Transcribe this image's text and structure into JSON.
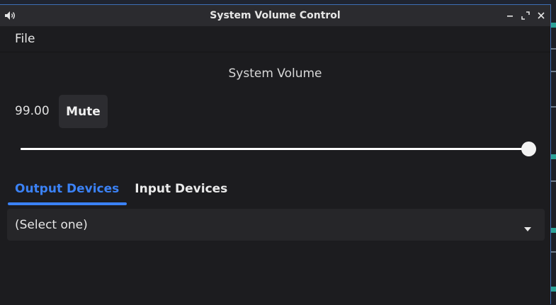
{
  "window": {
    "title": "System Volume Control"
  },
  "menu": {
    "items": [
      {
        "label": "File"
      }
    ]
  },
  "main": {
    "heading": "System Volume",
    "volume_value": "99.00",
    "volume_percent": 99,
    "mute_label": "Mute",
    "tabs": [
      {
        "label": "Output Devices",
        "active": true
      },
      {
        "label": "Input Devices",
        "active": false
      }
    ],
    "device_select": {
      "value": "(Select one)"
    }
  },
  "colors": {
    "accent": "#3b82f6",
    "window_bg": "#1c1c1f",
    "titlebar_bg": "#2b2b2f"
  },
  "icons": {
    "app": "speaker-icon",
    "minimize": "minimize-icon",
    "maximize": "maximize-icon",
    "close": "close-icon",
    "caret": "caret-down-icon"
  }
}
